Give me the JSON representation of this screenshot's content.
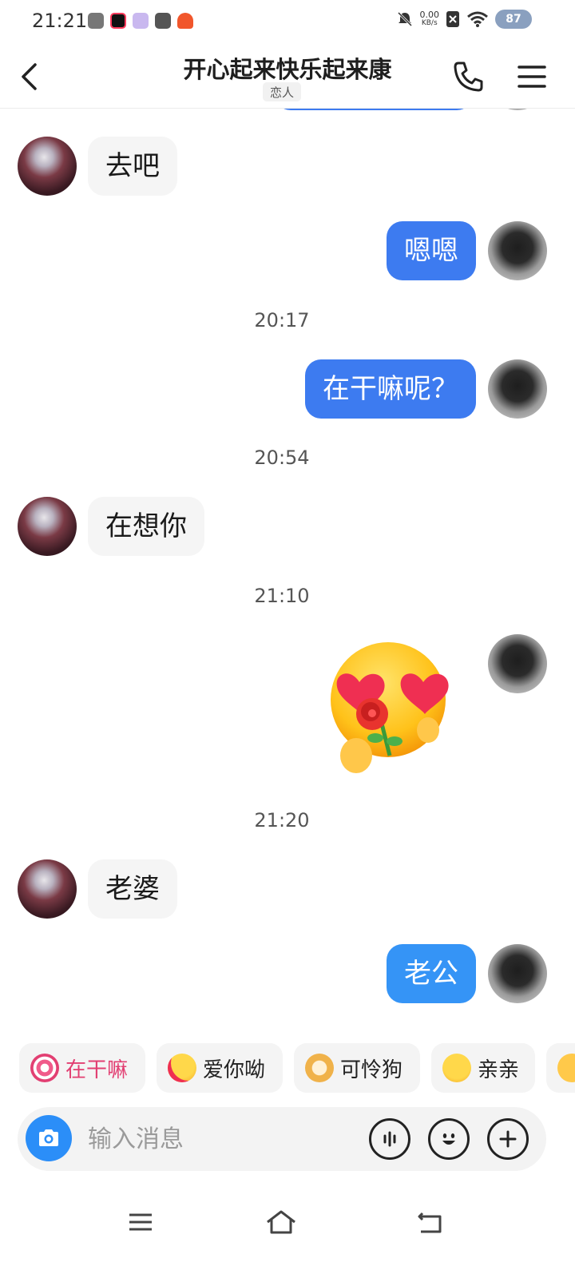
{
  "status_bar": {
    "time": "21:21",
    "net_speed_value": "0.00",
    "net_speed_unit": "KB/s",
    "battery": "87"
  },
  "header": {
    "title": "开心起来快乐起来康",
    "relation_tag": "恋人"
  },
  "messages": [
    {
      "side": "in",
      "text": "去吧"
    },
    {
      "side": "out",
      "text": "嗯嗯"
    },
    {
      "timestamp": "20:17"
    },
    {
      "side": "out",
      "text": "在干嘛呢？"
    },
    {
      "timestamp": "20:54"
    },
    {
      "side": "in",
      "text": "在想你"
    },
    {
      "timestamp": "21:10"
    },
    {
      "side": "out",
      "sticker": "heart-eyes-rose-sticker"
    },
    {
      "timestamp": "21:20"
    },
    {
      "side": "in",
      "text": "老婆"
    },
    {
      "side": "out",
      "text": "老公"
    }
  ],
  "quick_replies": [
    {
      "label": "在干嘛",
      "icon": "pink-swirl-icon"
    },
    {
      "label": "爱你呦",
      "icon": "heart-eyes-emoji-icon"
    },
    {
      "label": "可怜狗",
      "icon": "puppy-emoji-icon"
    },
    {
      "label": "亲亲",
      "icon": "hug-emoji-icon"
    }
  ],
  "input": {
    "placeholder": "输入消息"
  },
  "colors": {
    "bubble_out": "#3d7bf0",
    "bubble_out_latest": "#3594f6",
    "bubble_in": "#f5f5f5",
    "camera_button": "#2b8ef8",
    "quick_reply_accent": "#e23f72"
  }
}
